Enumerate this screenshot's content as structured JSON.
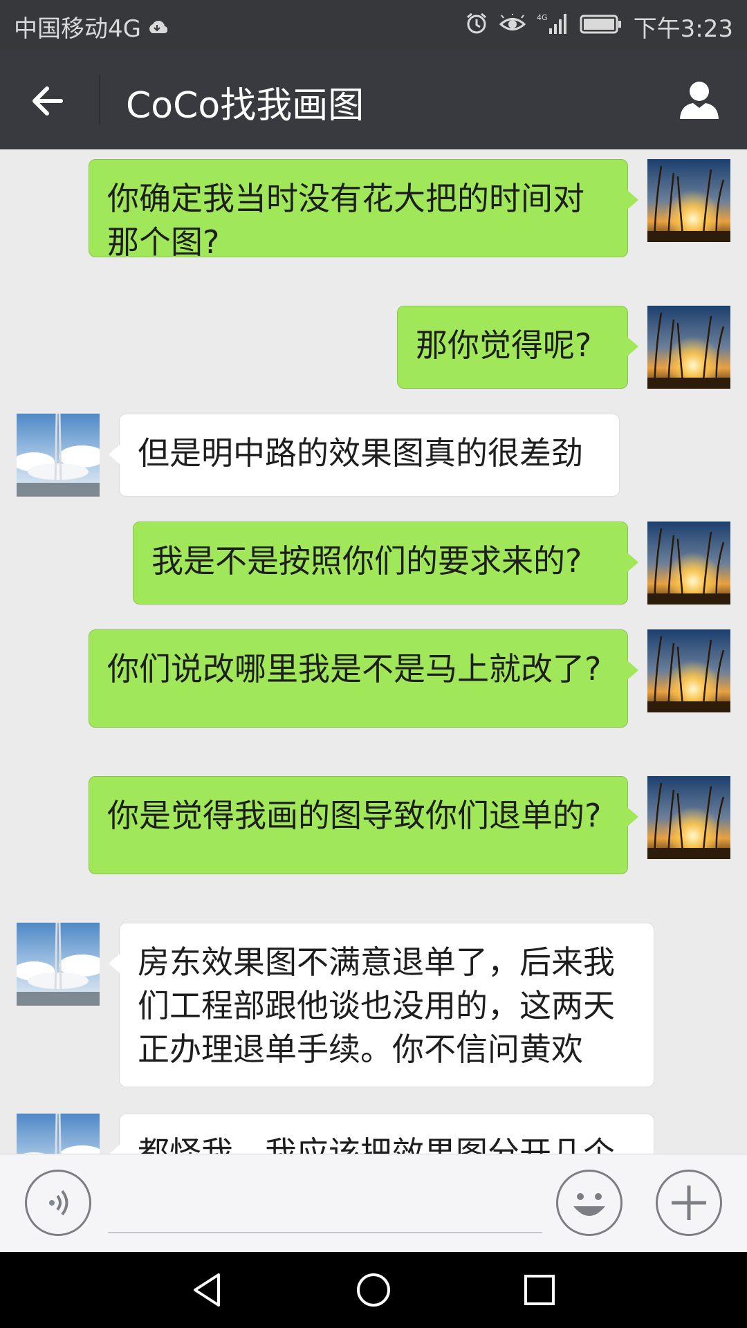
{
  "status_bar": {
    "carrier": "中国移动4G",
    "time": "下午3:23",
    "network": "4G",
    "icons": [
      "cloud-icon",
      "alarm-icon",
      "eye-icon",
      "signal-icon",
      "battery-icon"
    ]
  },
  "header": {
    "title": "CoCo找我画图",
    "back_icon": "arrow-left-icon",
    "profile_icon": "person-icon"
  },
  "messages": [
    {
      "side": "sent",
      "text": "你确定我当时没有花大把的时间对那个图?"
    },
    {
      "side": "sent",
      "text": "那你觉得呢?"
    },
    {
      "side": "received",
      "text": "但是明中路的效果图真的很差劲"
    },
    {
      "side": "sent",
      "text": "我是不是按照你们的要求来的?"
    },
    {
      "side": "sent",
      "text": "你们说改哪里我是不是马上就改了?"
    },
    {
      "side": "sent",
      "text": "你是觉得我画的图导致你们退单的?"
    },
    {
      "side": "received",
      "text": "房东效果图不满意退单了，后来我们工程部跟他谈也没用的，这两天正办理退单手续。你不信问黄欢"
    },
    {
      "side": "received",
      "text": "都怪我，我应该把效果图分开几个"
    }
  ],
  "avatars": {
    "sent": "sunset-grass-avatar",
    "received": "sky-tower-avatar"
  },
  "input_bar": {
    "placeholder": "",
    "voice_icon": "voice-icon",
    "emoji_icon": "emoji-icon",
    "plus_icon": "plus-icon"
  },
  "nav_bar": {
    "icons": [
      "back-triangle-icon",
      "home-circle-icon",
      "recent-square-icon"
    ]
  },
  "colors": {
    "sent_bubble": "#a0e75a",
    "received_bubble": "#ffffff",
    "header": "#393a3f",
    "background": "#ebebeb"
  }
}
